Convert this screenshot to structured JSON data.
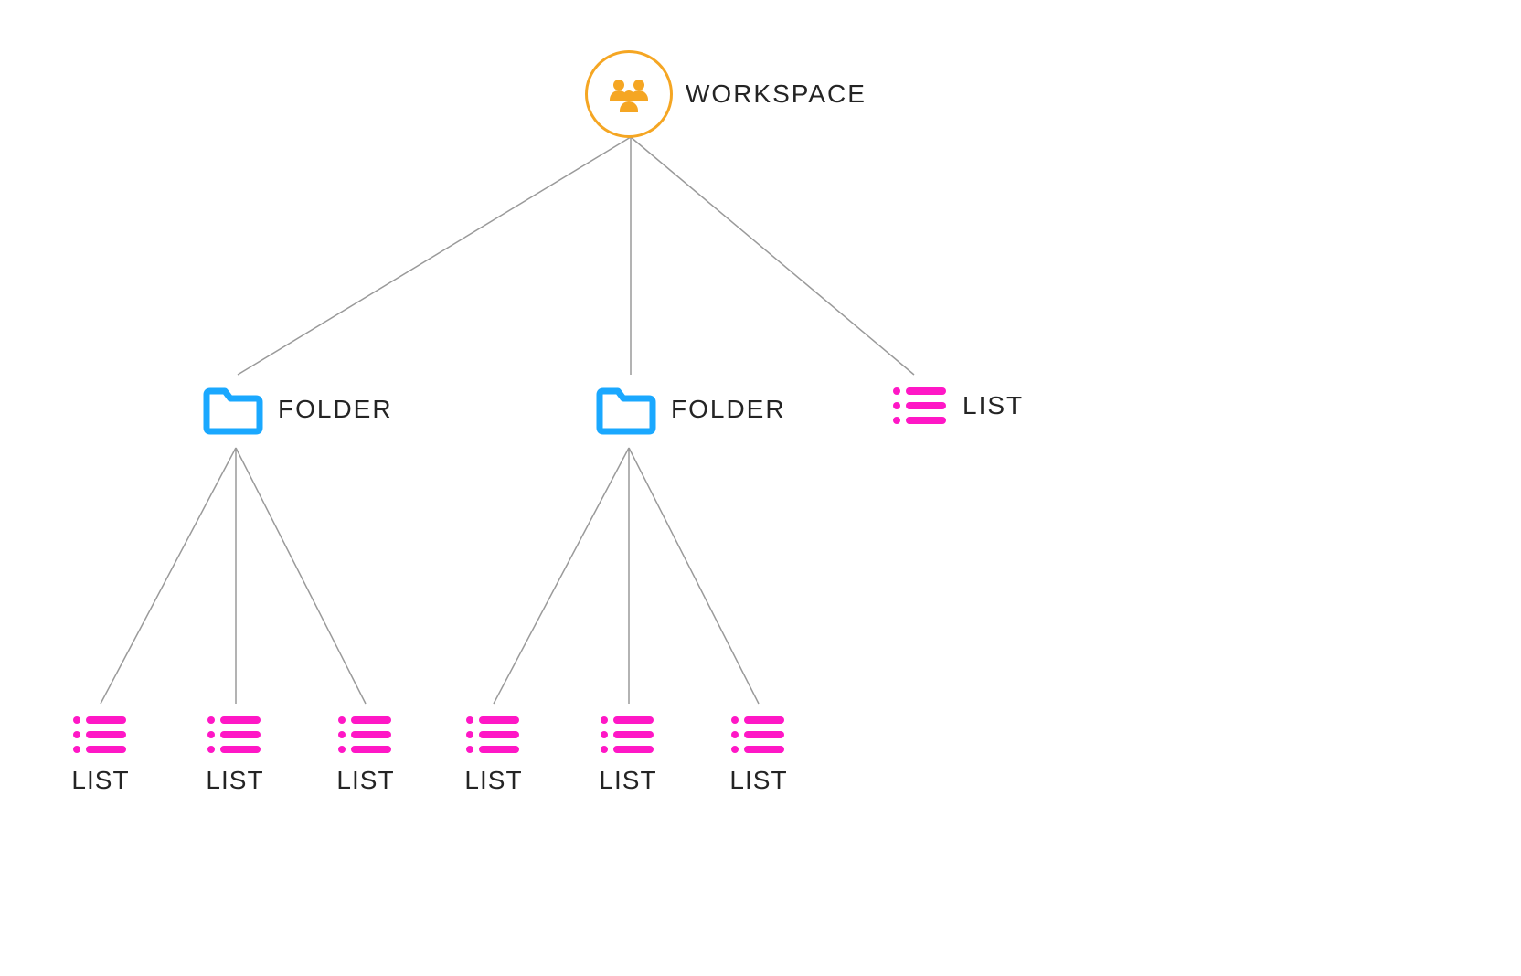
{
  "colors": {
    "workspace": "#f5a623",
    "folder": "#1aa8ff",
    "list": "#ff17c6",
    "line": "#9a9a9a",
    "text": "#242424"
  },
  "root": {
    "label": "WORKSPACE"
  },
  "level2": [
    {
      "type": "folder",
      "label": "FOLDER"
    },
    {
      "type": "folder",
      "label": "FOLDER"
    },
    {
      "type": "list",
      "label": "LIST"
    }
  ],
  "leaves_group1": [
    {
      "label": "LIST"
    },
    {
      "label": "LIST"
    },
    {
      "label": "LIST"
    }
  ],
  "leaves_group2": [
    {
      "label": "LIST"
    },
    {
      "label": "LIST"
    },
    {
      "label": "LIST"
    }
  ]
}
